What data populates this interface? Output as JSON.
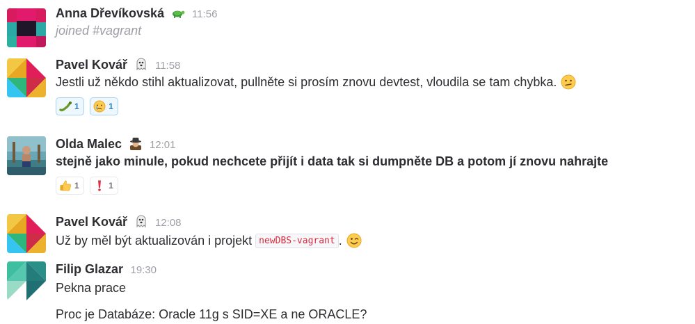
{
  "messages": [
    {
      "author": "Anna Dřevíkovská",
      "status_icon": "turtle-icon",
      "time": "11:56",
      "text": "joined #vagrant"
    },
    {
      "author": "Pavel Kovář",
      "status_icon": "ghost-icon",
      "time": "11:58",
      "text": "Jestli už někdo stihl aktualizovat, pullněte si prosím znovu devtest, vloudila se tam chybka.",
      "inline_emoji": "confused-face-icon",
      "reactions": [
        {
          "emoji": "snake-icon",
          "count": "1",
          "active": true
        },
        {
          "emoji": "crying-face-icon",
          "count": "1",
          "active": true
        }
      ]
    },
    {
      "author": "Olda Malec",
      "status_icon": "spy-icon",
      "time": "12:01",
      "text": "stejně jako minule, pokud nechcete přijít i data tak si dumpněte DB a potom jí znovu nahrajte",
      "reactions": [
        {
          "emoji": "thumbs-up-icon",
          "count": "1",
          "active": false
        },
        {
          "emoji": "exclamation-icon",
          "count": "1",
          "active": false
        }
      ]
    },
    {
      "author": "Pavel Kovář",
      "status_icon": "ghost-icon",
      "time": "12:08",
      "text_before": "Už by měl být aktualizován i projekt",
      "code": "newDBS-vagrant",
      "text_after": ".",
      "inline_emoji": "winking-face-icon"
    },
    {
      "author": "Filip Glazar",
      "time": "19:30",
      "text": "Pekna prace",
      "followup": "Proc je Databáze: Oracle 11g s SID=XE a ne ORACLE?"
    }
  ],
  "colors": {
    "author": "#2c2d30",
    "timestamp": "#9e9ea6",
    "code_text": "#d72b3f",
    "reaction_active_border": "#a6d2f7",
    "reaction_active_count": "#2a80b9"
  }
}
